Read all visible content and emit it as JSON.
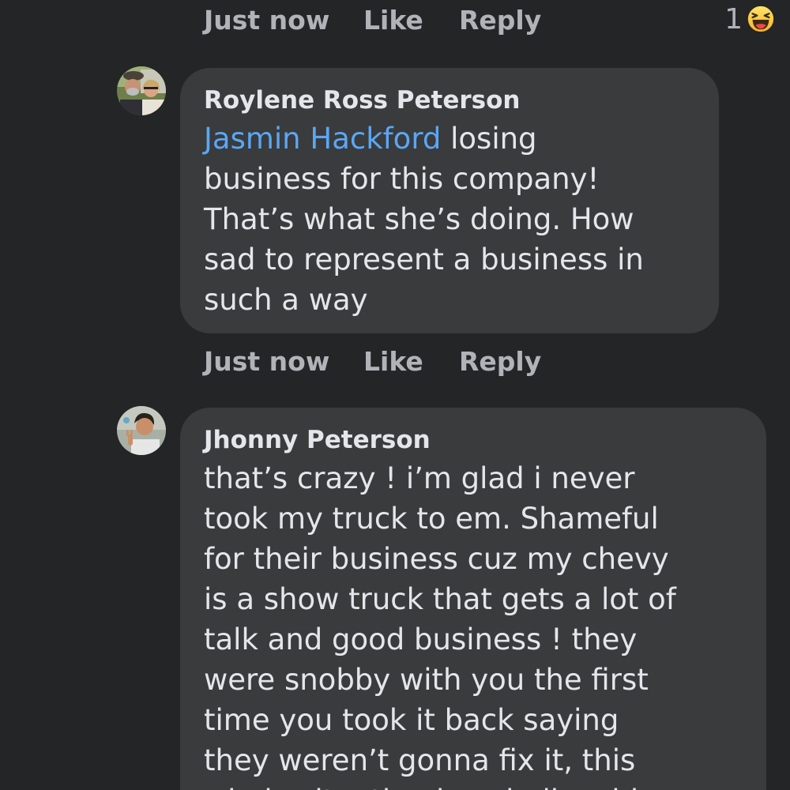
{
  "top_meta": {
    "time": "Just now",
    "like": "Like",
    "reply": "Reply",
    "reaction_count": "1",
    "reaction_icon": "haha-emoji-icon"
  },
  "comments": [
    {
      "author": "Roylene Ross Peterson",
      "mention": "Jasmin Hackford",
      "text": " losing\nbusiness for this company!\nThat’s what she’s doing. How\nsad to represent a business in\nsuch a way",
      "time": "Just now",
      "like": "Like",
      "reply": "Reply",
      "avatar_icon": "couple-avatar"
    },
    {
      "author": "Jhonny Peterson",
      "text": "that’s crazy ! i’m glad i never\ntook my truck to em. Shameful\nfor their business cuz my chevy\nis a show truck that gets a lot of\ntalk and good business ! they\nwere snobby with you the first\ntime you took it back saying\nthey weren’t gonna fix it, this\nwhole situation is unbelievable",
      "avatar_icon": "man-avatar"
    }
  ],
  "colors": {
    "background": "#242526",
    "bubble": "#3a3b3c",
    "text": "#e4e6eb",
    "secondary_text": "#b0b3b8",
    "mention": "#5aa7f5"
  }
}
